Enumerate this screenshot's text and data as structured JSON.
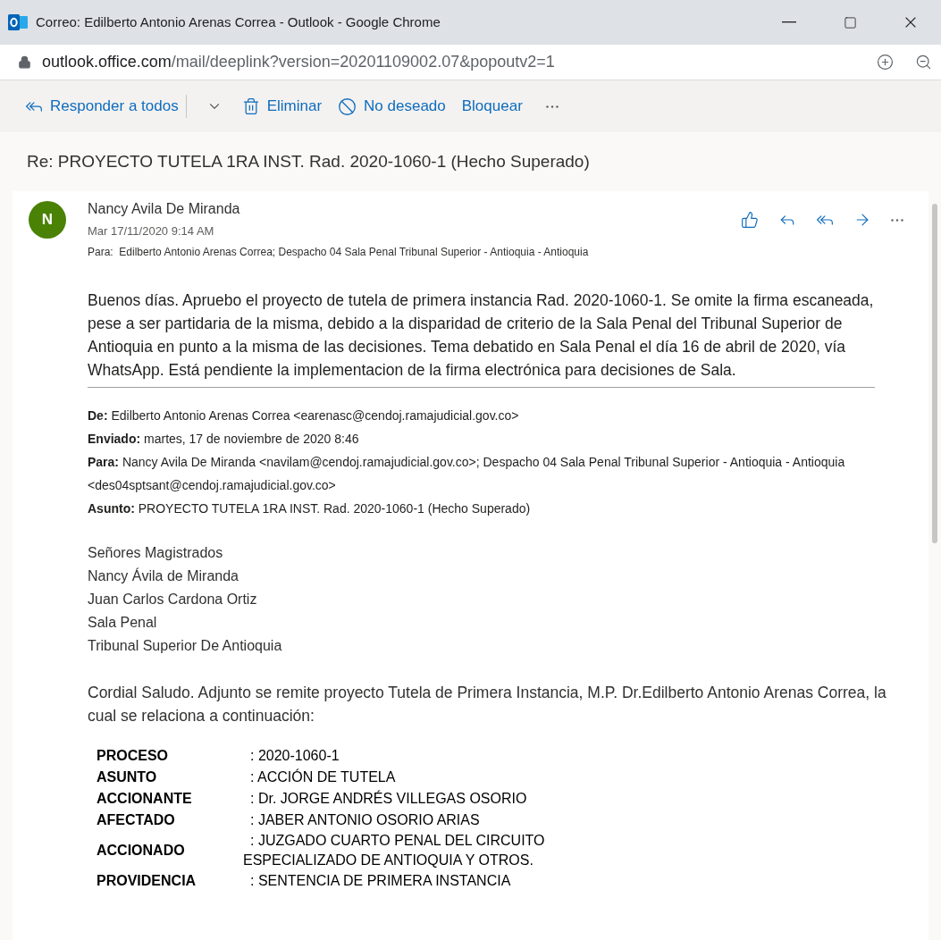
{
  "window": {
    "title": "Correo: Edilberto Antonio Arenas Correa - Outlook - Google Chrome"
  },
  "address_bar": {
    "domain": "outlook.office.com",
    "path": "/mail/deeplink?version=20201109002.07&popoutv2=1"
  },
  "toolbar": {
    "items": [
      {
        "kind": "reply-all",
        "label": "Responder a todos"
      },
      {
        "kind": "dropdown"
      },
      {
        "kind": "delete",
        "label": "Eliminar"
      },
      {
        "kind": "junk",
        "label": "No deseado"
      },
      {
        "kind": "plain",
        "label": "Bloquear"
      },
      {
        "kind": "more"
      }
    ]
  },
  "subject": "Re: PROYECTO TUTELA 1RA INST. Rad. 2020-1060-1 (Hecho Superado)",
  "message": {
    "avatar_initial": "N",
    "sender": "Nancy Avila De Miranda",
    "date": "Mar 17/11/2020 9:14 AM",
    "to_label": "Para:",
    "to": "Edilberto Antonio Arenas Correa; Despacho 04 Sala Penal Tribunal Superior - Antioquia - Antioquia",
    "body": "Buenos días. Apruebo el proyecto de tutela de primera instancia Rad. 2020-1060-1. Se omite la firma escaneada, pese a ser partidaria de la misma, debido a la disparidad de criterio de la Sala Penal del Tribunal Superior de Antioquia en punto a la misma de las decisiones. Tema debatido en Sala Penal el día 16 de abril de 2020, vía WhatsApp. Está pendiente la implementacion de la firma electrónica para decisiones de Sala.",
    "quoted_header": [
      {
        "label": "De:",
        "value": "Edilberto Antonio Arenas Correa <earenasc@cendoj.ramajudicial.gov.co>"
      },
      {
        "label": "Enviado:",
        "value": "martes, 17 de noviembre de 2020 8:46"
      },
      {
        "label": "Para:",
        "value": "Nancy Avila De Miranda <navilam@cendoj.ramajudicial.gov.co>; Despacho 04 Sala Penal Tribunal Superior - Antioquia - Antioquia <des04sptsant@cendoj.ramajudicial.gov.co>"
      },
      {
        "label": "Asunto:",
        "value": "PROYECTO TUTELA 1RA INST. Rad. 2020-1060-1 (Hecho Superado)"
      }
    ],
    "greeting_lines": [
      "Señores Magistrados",
      "Nancy Ávila de Miranda",
      "Juan Carlos Cardona Ortiz",
      "Sala Penal",
      "Tribunal Superior De Antioquia"
    ],
    "intro": "Cordial Saludo. Adjunto se remite proyecto Tutela de Primera Instancia, M.P. Dr.Edilberto Antonio Arenas Correa, la cual se relaciona a continuación:",
    "table": [
      {
        "label": "PROCESO",
        "value": [
          ": 2020-1060-1"
        ]
      },
      {
        "label": "ASUNTO",
        "value": [
          ": ACCIÓN DE TUTELA"
        ]
      },
      {
        "label": "ACCIONANTE",
        "value": [
          ": Dr. JORGE ANDRÉS VILLEGAS OSORIO"
        ]
      },
      {
        "label": "AFECTADO",
        "value": [
          ": JABER ANTONIO OSORIO ARIAS"
        ]
      },
      {
        "label": "ACCIONADO",
        "value": [
          ": JUZGADO CUARTO PENAL DEL CIRCUITO",
          "ESPECIALIZADO DE ANTIOQUIA Y OTROS."
        ]
      },
      {
        "label": "PROVIDENCIA",
        "value": [
          ": SENTENCIA DE PRIMERA INSTANCIA"
        ]
      }
    ]
  }
}
